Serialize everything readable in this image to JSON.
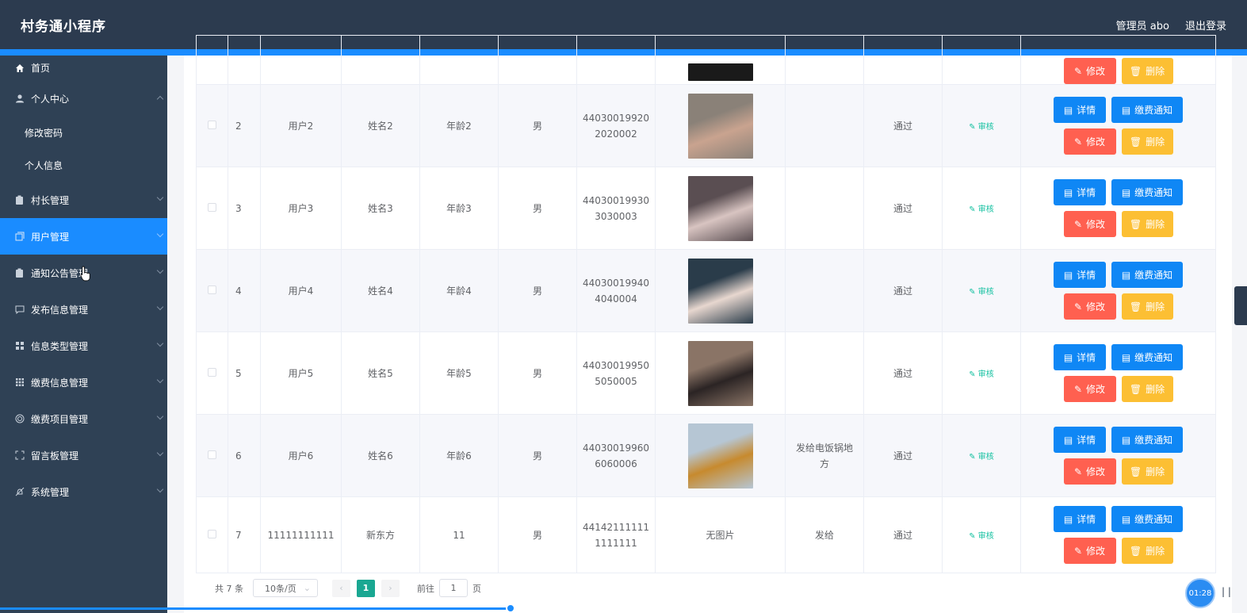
{
  "header": {
    "title": "村务通小程序",
    "admin_label": "管理员 abo",
    "logout_label": "退出登录"
  },
  "sidebar": {
    "items": [
      {
        "label": "首页",
        "icon": "home-icon"
      },
      {
        "label": "个人中心",
        "icon": "user-icon",
        "expanded": true,
        "subitems": [
          "修改密码",
          "个人信息"
        ]
      },
      {
        "label": "村长管理",
        "icon": "clipboard-icon"
      },
      {
        "label": "用户管理",
        "icon": "copy-icon",
        "active": true
      },
      {
        "label": "通知公告管理",
        "icon": "clipboard-icon"
      },
      {
        "label": "发布信息管理",
        "icon": "chat-icon"
      },
      {
        "label": "信息类型管理",
        "icon": "grid-icon"
      },
      {
        "label": "缴费信息管理",
        "icon": "grid9-icon"
      },
      {
        "label": "缴费项目管理",
        "icon": "target-icon"
      },
      {
        "label": "留言板管理",
        "icon": "frame-icon"
      },
      {
        "label": "系统管理",
        "icon": "bell-off-icon"
      }
    ]
  },
  "table": {
    "rows": [
      {
        "idx": "2",
        "username": "用户2",
        "name": "姓名2",
        "age": "年龄2",
        "gender": "男",
        "idcard_a": "44030019920",
        "idcard_b": "2020002",
        "photo_colors": [
          "#8a8178",
          "#c9a38f"
        ],
        "address": "",
        "status": "通过",
        "review": "审核"
      },
      {
        "idx": "3",
        "username": "用户3",
        "name": "姓名3",
        "age": "年龄3",
        "gender": "男",
        "idcard_a": "44030019930",
        "idcard_b": "3030003",
        "photo_colors": [
          "#5a4e52",
          "#d8c4c1"
        ],
        "address": "",
        "status": "通过",
        "review": "审核"
      },
      {
        "idx": "4",
        "username": "用户4",
        "name": "姓名4",
        "age": "年龄4",
        "gender": "男",
        "idcard_a": "44030019940",
        "idcard_b": "4040004",
        "photo_colors": [
          "#2a3c4a",
          "#e7d7cf"
        ],
        "address": "",
        "status": "通过",
        "review": "审核"
      },
      {
        "idx": "5",
        "username": "用户5",
        "name": "姓名5",
        "age": "年龄5",
        "gender": "男",
        "idcard_a": "44030019950",
        "idcard_b": "5050005",
        "photo_colors": [
          "#8a7466",
          "#2b2424"
        ],
        "address": "",
        "status": "通过",
        "review": "审核"
      },
      {
        "idx": "6",
        "username": "用户6",
        "name": "姓名6",
        "age": "年龄6",
        "gender": "男",
        "idcard_a": "44030019960",
        "idcard_b": "6060006",
        "photo_colors": [
          "#b6c6d4",
          "#c78a2e"
        ],
        "address_a": "发给电饭锅地",
        "address_b": "方",
        "status": "通过",
        "review": "审核"
      },
      {
        "idx": "7",
        "username": "11111111111",
        "name": "新东方",
        "age": "11",
        "gender": "男",
        "idcard_a": "44142111111",
        "idcard_b": "1111111",
        "photo_text": "无图片",
        "address": "发给",
        "status": "通过",
        "review": "审核"
      }
    ],
    "buttons": {
      "detail": "详情",
      "notify": "缴费通知",
      "edit": "修改",
      "delete": "删除"
    }
  },
  "pagination": {
    "total": "共 7 条",
    "page_size": "10条/页",
    "current": "1",
    "goto_prefix": "前往",
    "goto_value": "1",
    "goto_suffix": "页"
  },
  "player": {
    "time": "01:28",
    "progress": 0.41
  },
  "colors": {
    "primary": "#1a8cff",
    "header_bg": "#2c3b4f",
    "sidebar_bg": "#2f4155",
    "danger": "#ff6050",
    "warning": "#fcbf33",
    "success": "#1aa792"
  }
}
